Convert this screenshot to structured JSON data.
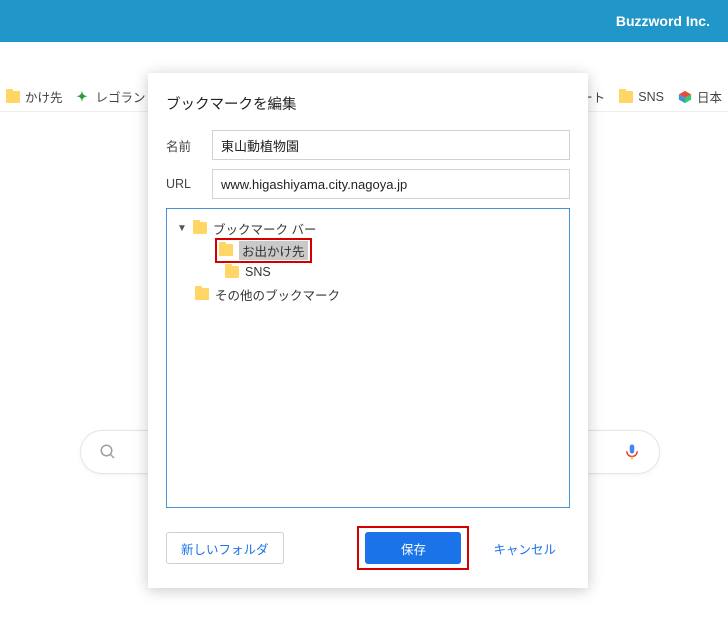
{
  "header": {
    "brand": "Buzzword Inc."
  },
  "bookmarks_bar": {
    "item_left": "かけ先",
    "item_lego": "レゴランド®・ジ",
    "item_cut": "ート",
    "item_sns": "SNS",
    "item_jp": "日本"
  },
  "dialog": {
    "title": "ブックマークを編集",
    "name_label": "名前",
    "name_value": "東山動植物園",
    "url_label": "URL",
    "url_value": "www.higashiyama.city.nagoya.jp",
    "tree": {
      "root": "ブックマーク バー",
      "child_selected": "お出かけ先",
      "child_sns": "SNS",
      "other": "その他のブックマーク"
    },
    "buttons": {
      "new_folder": "新しいフォルダ",
      "save": "保存",
      "cancel": "キャンセル"
    }
  }
}
